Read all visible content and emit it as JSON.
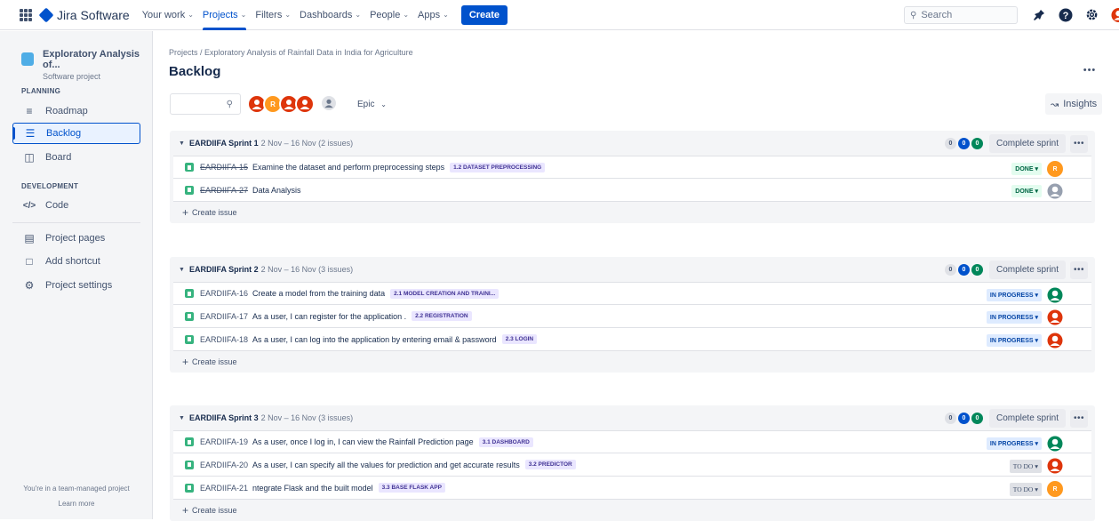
{
  "topbar": {
    "product": "Jira Software",
    "nav": [
      {
        "label": "Your work",
        "active": false
      },
      {
        "label": "Projects",
        "active": true
      },
      {
        "label": "Filters",
        "active": false
      },
      {
        "label": "Dashboards",
        "active": false
      },
      {
        "label": "People",
        "active": false
      },
      {
        "label": "Apps",
        "active": false
      }
    ],
    "create_label": "Create",
    "search_placeholder": "Search",
    "icons": [
      "notifications-icon",
      "help-icon",
      "settings-icon",
      "profile-icon"
    ]
  },
  "sidebar": {
    "project_name": "Exploratory Analysis of...",
    "project_type": "Software project",
    "planning_title": "PLANNING",
    "planning_items": [
      {
        "label": "Roadmap",
        "icon": "roadmap-icon"
      },
      {
        "label": "Backlog",
        "icon": "backlog-icon",
        "active": true
      },
      {
        "label": "Board",
        "icon": "board-icon"
      }
    ],
    "development_title": "DEVELOPMENT",
    "development_items": [
      {
        "label": "Code",
        "icon": "code-icon"
      }
    ],
    "other_items": [
      {
        "label": "Project pages",
        "icon": "pages-icon"
      },
      {
        "label": "Add shortcut",
        "icon": "add-shortcut-icon"
      },
      {
        "label": "Project settings",
        "icon": "settings-icon"
      }
    ],
    "footer_text": "You're in a team-managed project",
    "footer_link": "Learn more"
  },
  "main": {
    "breadcrumb": "Projects  /  Exploratory Analysis of Rainfall Data in India for Agriculture",
    "title": "Backlog",
    "epic_filter": "Epic",
    "insights_label": "Insights",
    "avatars": [
      {
        "initial": "",
        "color": "#de350b"
      },
      {
        "initial": "R",
        "color": "#ff991f"
      },
      {
        "initial": "",
        "color": "#de350b"
      },
      {
        "initial": "",
        "color": "#de350b"
      }
    ],
    "complete_label": "Complete sprint",
    "create_issue_label": "Create issue"
  },
  "sprints": [
    {
      "name": "EARDIIFA Sprint 1",
      "dates": "2 Nov – 16 Nov  (2 issues)",
      "counts": [
        "0",
        "0",
        "0"
      ],
      "issues": [
        {
          "key": "EARDIIFA-15",
          "summary": "Examine the dataset and perform preprocessing steps",
          "epic": "1.2 DATASET PREPROCESSING",
          "status": "DONE",
          "done": true,
          "assignee": "R",
          "assignee_color": "#ff991f"
        },
        {
          "key": "EARDIIFA-27",
          "summary": "Data Analysis",
          "epic": "",
          "status": "DONE",
          "done": true,
          "assignee": "",
          "assignee_color": "#97a0af"
        }
      ]
    },
    {
      "name": "EARDIIFA Sprint 2",
      "dates": "2 Nov – 16 Nov  (3 issues)",
      "counts": [
        "0",
        "0",
        "0"
      ],
      "issues": [
        {
          "key": "EARDIIFA-16",
          "summary": "Create a model from the training data",
          "epic": "2.1 MODEL CREATION AND TRAINI...",
          "status": "IN PROGRESS",
          "done": false,
          "assignee": "",
          "assignee_color": "#00875a"
        },
        {
          "key": "EARDIIFA-17",
          "summary": "As a user, I can register for the application .",
          "epic": "2.2 REGISTRATION",
          "status": "IN PROGRESS",
          "done": false,
          "assignee": "",
          "assignee_color": "#de350b"
        },
        {
          "key": "EARDIIFA-18",
          "summary": "As a user, I can log into the application by entering email & password",
          "epic": "2.3 LOGIN",
          "status": "IN PROGRESS",
          "done": false,
          "assignee": "",
          "assignee_color": "#de350b"
        }
      ]
    },
    {
      "name": "EARDIIFA Sprint 3",
      "dates": "2 Nov – 16 Nov  (3 issues)",
      "counts": [
        "0",
        "0",
        "0"
      ],
      "issues": [
        {
          "key": "EARDIIFA-19",
          "summary": "As a user, once I log in, I can view the Rainfall Prediction page",
          "epic": "3.1 DASHBOARD",
          "status": "IN PROGRESS",
          "done": false,
          "assignee": "",
          "assignee_color": "#00875a"
        },
        {
          "key": "EARDIIFA-20",
          "summary": "As a user, I can specify all the values for prediction and get accurate results",
          "epic": "3.2 PREDICTOR",
          "status": "TO DO",
          "done": false,
          "assignee": "",
          "assignee_color": "#de350b"
        },
        {
          "key": "EARDIIFA-21",
          "summary": "ntegrate Flask and the built model",
          "epic": "3.3 BASE FLASK APP",
          "status": "TO DO",
          "done": false,
          "assignee": "R",
          "assignee_color": "#ff991f"
        }
      ]
    }
  ]
}
